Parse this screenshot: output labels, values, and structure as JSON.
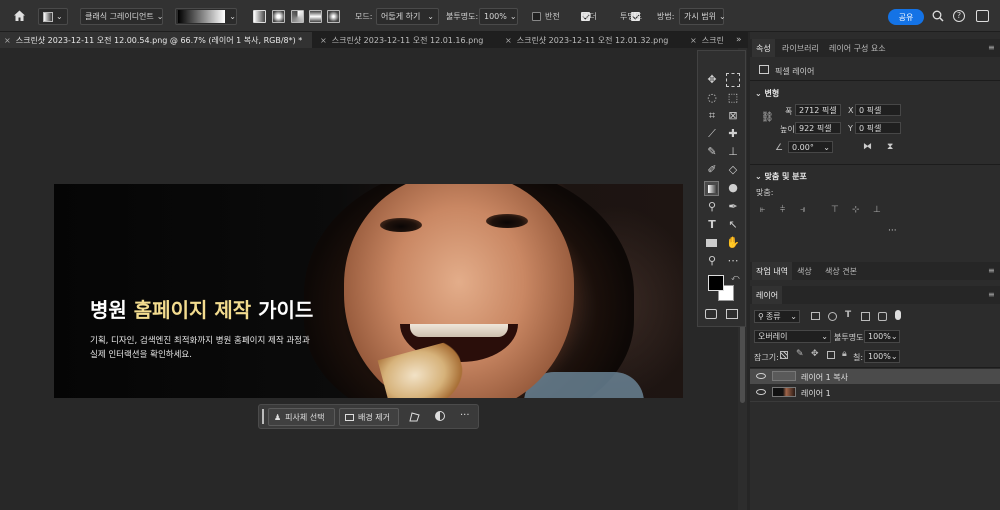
{
  "options_bar": {
    "gradient_type": "클래식 그레이디언트",
    "mode_label": "모드:",
    "mode_value": "어둡게 하기",
    "opacity_label": "불투명도:",
    "opacity_value": "100%",
    "reverse_label": "반전",
    "dither_label": "디더",
    "transparency_label": "투명도",
    "method_label": "방법:",
    "method_value": "가시 범위",
    "share_label": "공유"
  },
  "tabs": [
    {
      "label": "스크린샷 2023-12-11 오전 12.00.54.png @ 66.7% (레이어 1 복사, RGB/8*) *",
      "active": true
    },
    {
      "label": "스크린샷 2023-12-11 오전 12.01.16.png",
      "active": false
    },
    {
      "label": "스크린샷 2023-12-11 오전 12.01.32.png",
      "active": false
    },
    {
      "label": "스크린",
      "active": false
    }
  ],
  "banner": {
    "title_pre": "병원 ",
    "title_highlight": "홈페이지 제작",
    "title_post": " 가이드",
    "desc_line1": "기획, 디자인, 검색엔진 최적화까지 병원 홈페이지 제작 과정과",
    "desc_line2": "실제 인터랙션을 확인하세요."
  },
  "context_bar": {
    "select_subject": "피사체 선택",
    "remove_bg": "배경 제거",
    "more": "···"
  },
  "properties": {
    "tabs": [
      "속성",
      "라이브러리",
      "레이어 구성 요소"
    ],
    "layer_type": "픽셀 레이어",
    "transform_header": "변형",
    "w_label": "폭",
    "w_value": "2712 픽셀",
    "h_label": "높이",
    "h_value": "922 픽셀",
    "x_label": "X",
    "x_value": "0 픽셀",
    "y_label": "Y",
    "y_value": "0 픽셀",
    "angle_value": "0.00°",
    "align_header": "맞춤 및 분포",
    "align_label": "맞춤:",
    "more": "···"
  },
  "history_tabs": [
    "작업 내역",
    "색상",
    "색상 견본"
  ],
  "layers": {
    "tab": "레이어",
    "filter_kind": "종류",
    "blend_mode": "오버레이",
    "opacity_label": "불투명도:",
    "opacity_value": "100%",
    "lock_label": "잠그기:",
    "fill_label": "칠:",
    "fill_value": "100%",
    "items": [
      {
        "name": "레이어 1 복사",
        "selected": true
      },
      {
        "name": "레이어 1",
        "selected": false
      }
    ]
  }
}
